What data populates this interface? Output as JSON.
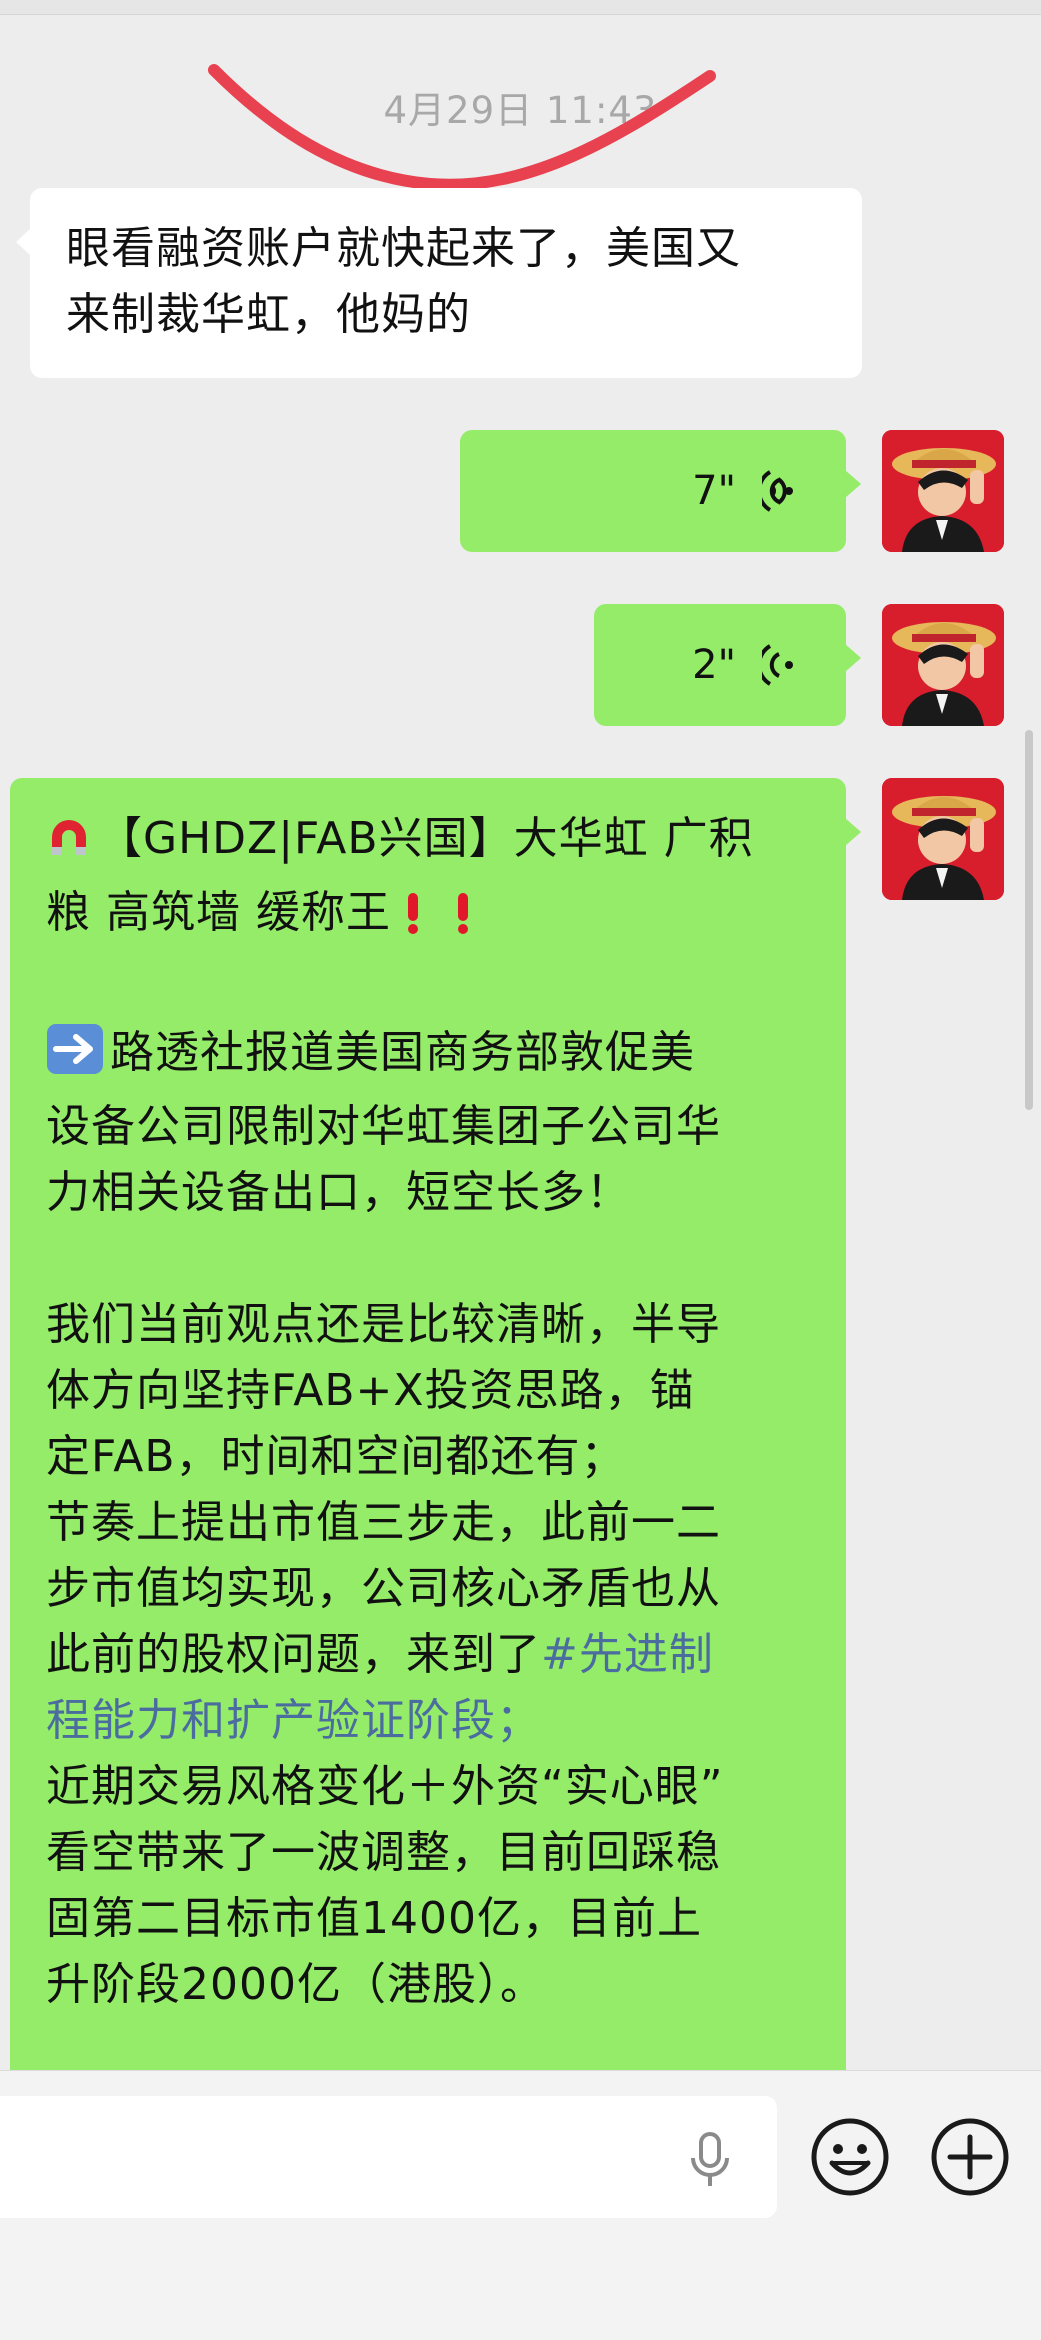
{
  "chat": {
    "timestamp": "4月29日 11:43",
    "messages": [
      {
        "side": "left",
        "type": "text",
        "text": "眼看融资账户就快起来了，美国又\n来制裁华虹，他妈的"
      },
      {
        "side": "right",
        "type": "voice",
        "duration": "7\""
      },
      {
        "side": "right",
        "type": "voice",
        "duration": "2\""
      },
      {
        "side": "right",
        "type": "text",
        "paragraphs": [
          "【GHDZ|FAB兴国】大华虹 广积\n粮 高筑墙 缓称王",
          "路透社报道美国商务部敦促美\n设备公司限制对华虹集团子公司华\n力相关设备出口，短空长多！",
          "我们当前观点还是比较清晰，半导\n体方向坚持FAB+X投资思路，锚\n定FAB，时间和空间都还有；\n节奏上提出市值三步走，此前一二\n步市值均实现，公司核心矛盾也从\n此前的股权问题，来到了",
          "#先进制\n程能力和扩产验证阶段；",
          "\n近期交易风格变化＋外资“实心眼”\n看空带来了一波调整，目前回踩稳\n固第二目标市值1400亿，目前上\n升阶段2000亿（港股）。"
        ],
        "emojis": [
          "magnet-icon",
          "exclamation-icon",
          "exclamation-icon",
          "arrow-right-icon"
        ]
      }
    ]
  },
  "colors": {
    "background": "#ededed",
    "bubble_green": "#95ec69",
    "bubble_white": "#ffffff",
    "hashtag": "#4b6c9e",
    "annotation_red": "#e8414f"
  },
  "input_bar": {
    "icons": [
      "voice-input-icon",
      "emoji-icon",
      "plus-icon"
    ]
  }
}
